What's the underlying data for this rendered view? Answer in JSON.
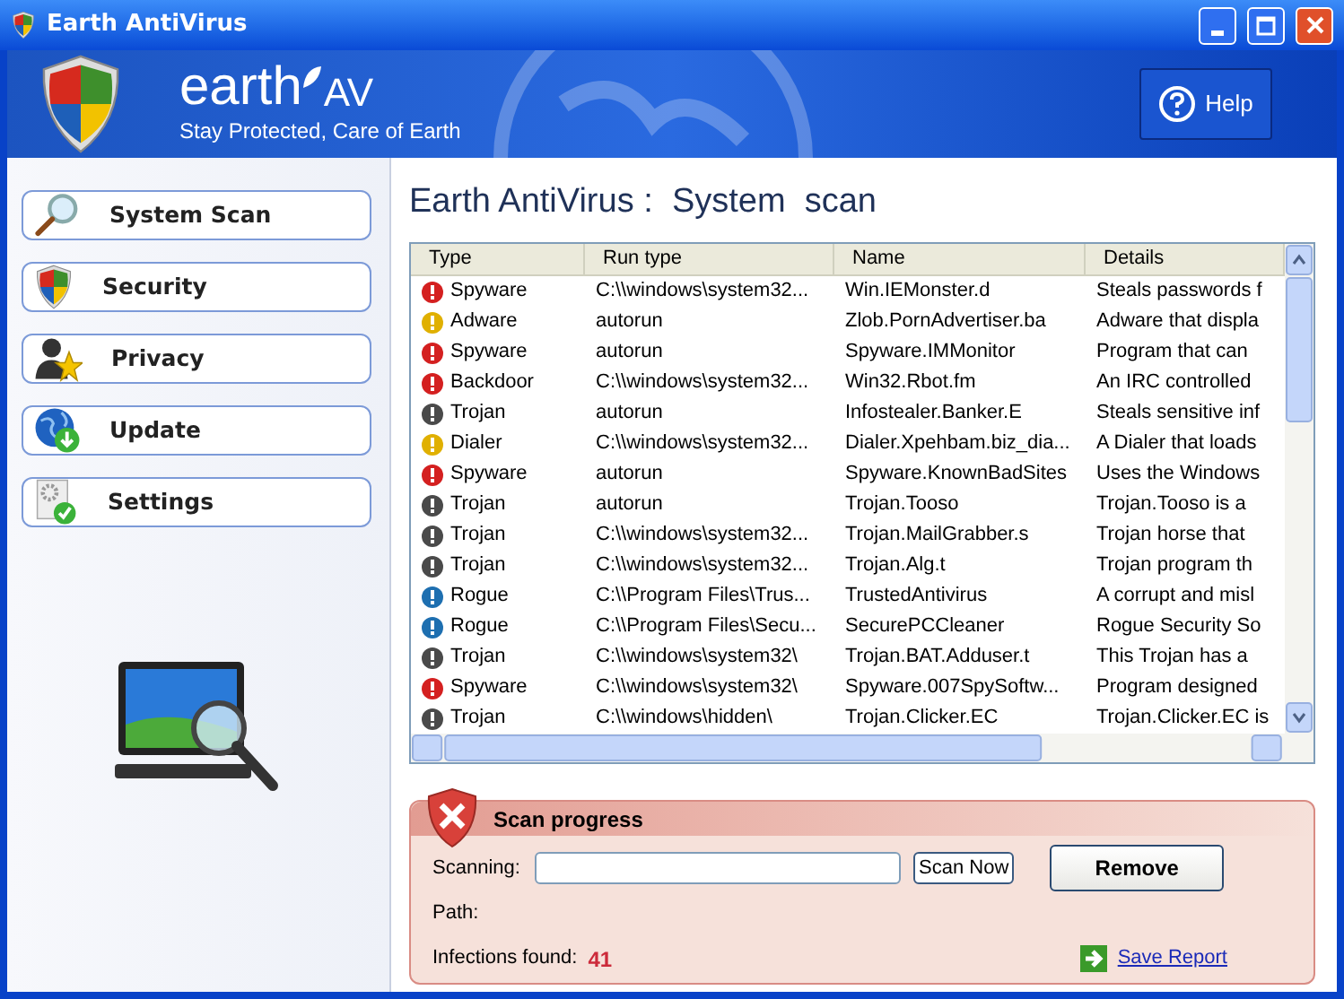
{
  "window": {
    "title": "Earth AntiVirus"
  },
  "header": {
    "brand": "earth",
    "brand_suffix": "AV",
    "tagline": "Stay Protected, Care of Earth",
    "help_button": "Help"
  },
  "sidebar": {
    "items": [
      {
        "label": "System Scan"
      },
      {
        "label": "Security"
      },
      {
        "label": "Privacy"
      },
      {
        "label": "Update"
      },
      {
        "label": "Settings"
      }
    ]
  },
  "main": {
    "heading": "Earth AntiVirus :  System  scan"
  },
  "table": {
    "columns": [
      "Type",
      "Run type",
      "Name",
      "Details"
    ],
    "rows": [
      {
        "type": "Spyware",
        "run_type": "C:\\\\windows\\system32...",
        "name": "Win.IEMonster.d",
        "details": "Steals passwords f",
        "color": "#d42020"
      },
      {
        "type": "Adware",
        "run_type": "autorun",
        "name": "Zlob.PornAdvertiser.ba",
        "details": "Adware that displa",
        "color": "#e0b000"
      },
      {
        "type": "Spyware",
        "run_type": "autorun",
        "name": "Spyware.IMMonitor",
        "details": "Program that can",
        "color": "#d42020"
      },
      {
        "type": "Backdoor",
        "run_type": "C:\\\\windows\\system32...",
        "name": "Win32.Rbot.fm",
        "details": "An IRC controlled",
        "color": "#d42020"
      },
      {
        "type": "Trojan",
        "run_type": "autorun",
        "name": "Infostealer.Banker.E",
        "details": "Steals sensitive inf",
        "color": "#4a4a4a"
      },
      {
        "type": "Dialer",
        "run_type": "C:\\\\windows\\system32...",
        "name": "Dialer.Xpehbam.biz_dia...",
        "details": "A Dialer that loads",
        "color": "#e0b000"
      },
      {
        "type": "Spyware",
        "run_type": "autorun",
        "name": "Spyware.KnownBadSites",
        "details": "Uses the Windows",
        "color": "#d42020"
      },
      {
        "type": "Trojan",
        "run_type": "autorun",
        "name": "Trojan.Tooso",
        "details": "Trojan.Tooso is a",
        "color": "#4a4a4a"
      },
      {
        "type": "Trojan",
        "run_type": "C:\\\\windows\\system32...",
        "name": "Trojan.MailGrabber.s",
        "details": "Trojan horse that",
        "color": "#4a4a4a"
      },
      {
        "type": "Trojan",
        "run_type": "C:\\\\windows\\system32...",
        "name": "Trojan.Alg.t",
        "details": "Trojan program th",
        "color": "#4a4a4a"
      },
      {
        "type": "Rogue",
        "run_type": "C:\\\\Program Files\\Trus...",
        "name": "TrustedAntivirus",
        "details": "A corrupt and misl",
        "color": "#1e6fb0"
      },
      {
        "type": "Rogue",
        "run_type": "C:\\\\Program Files\\Secu...",
        "name": "SecurePCCleaner",
        "details": "Rogue Security So",
        "color": "#1e6fb0"
      },
      {
        "type": "Trojan",
        "run_type": "C:\\\\windows\\system32\\",
        "name": "Trojan.BAT.Adduser.t",
        "details": "This Trojan has a",
        "color": "#4a4a4a"
      },
      {
        "type": "Spyware",
        "run_type": "C:\\\\windows\\system32\\",
        "name": "Spyware.007SpySoftw...",
        "details": "Program designed",
        "color": "#d42020"
      },
      {
        "type": "Trojan",
        "run_type": "C:\\\\windows\\hidden\\",
        "name": "Trojan.Clicker.EC",
        "details": "Trojan.Clicker.EC is",
        "color": "#4a4a4a"
      }
    ]
  },
  "scan_progress": {
    "title": "Scan progress",
    "scanning_label": "Scanning:",
    "scan_button": "Scan Now",
    "remove_button": "Remove",
    "path_label": "Path:",
    "infections_label": "Infections found:",
    "infections_count": "41",
    "save_report": "Save Report"
  }
}
